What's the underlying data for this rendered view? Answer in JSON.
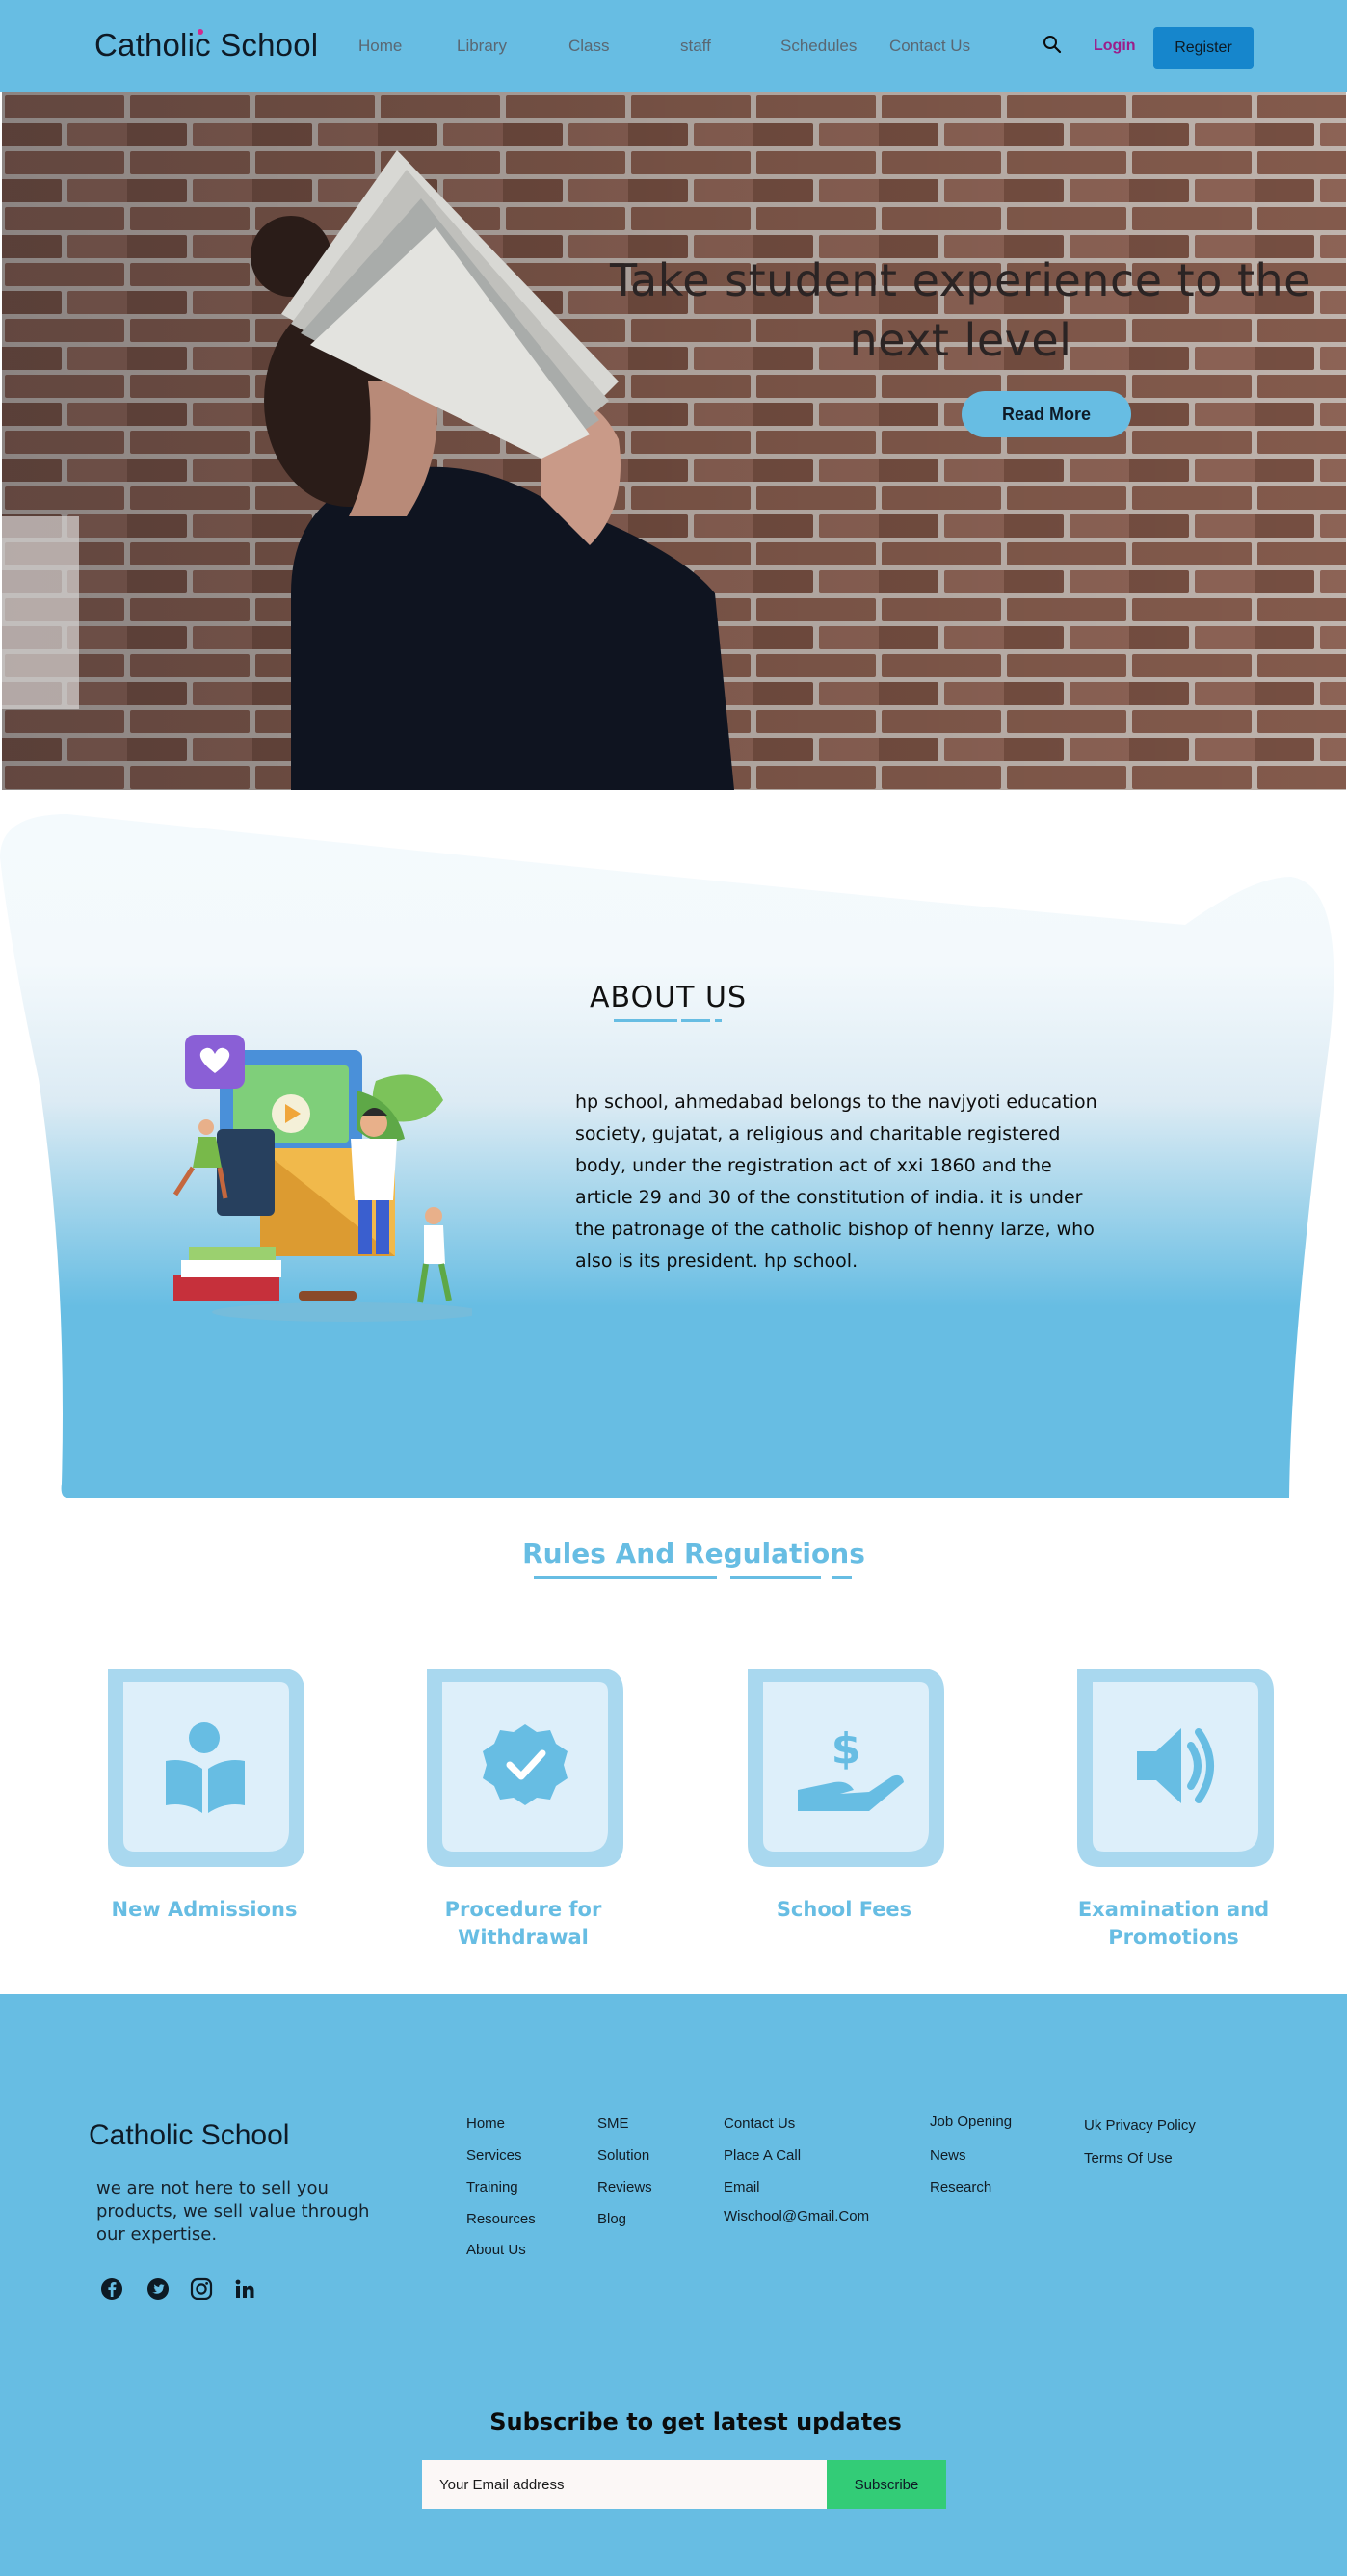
{
  "nav": {
    "brand": "Catholic School",
    "links": [
      "Home",
      "Library",
      "Class",
      "staff",
      "Schedules",
      "Contact Us"
    ],
    "login": "Login",
    "register": "Register"
  },
  "hero": {
    "title": "Take student experience to the next level",
    "cta": "Read More"
  },
  "about": {
    "title": "ABOUT US",
    "text": "hp school, ahmedabad belongs to the navjyoti education society, gujatat, a religious and charitable registered body, under the registration act of xxi 1860 and the article 29 and 30 of the constitution of india. it is under the patronage of the catholic bishop of henny larze, who also is its president. hp school."
  },
  "rules": {
    "title": "Rules And Regulations",
    "cards": [
      {
        "label": "New Admissions",
        "icon": "reading-person-icon"
      },
      {
        "label": "Procedure for Withdrawal",
        "icon": "verified-badge-icon"
      },
      {
        "label": "School Fees",
        "icon": "dollar-hand-icon"
      },
      {
        "label": "Examination and Promotions",
        "icon": "megaphone-icon"
      }
    ]
  },
  "footer": {
    "brand": "Catholic School",
    "tagline": "we are not here to sell you products, we sell value through our expertise.",
    "social": [
      "facebook-icon",
      "twitter-icon",
      "instagram-icon",
      "linkedin-icon"
    ],
    "col1": [
      "Home",
      "Services",
      "Training",
      "Resources",
      "About Us"
    ],
    "col2": [
      "SME",
      "Solution",
      "Reviews",
      "Blog"
    ],
    "col3": [
      "Contact Us",
      "Place A Call",
      "Email",
      "Wischool@Gmail.Com"
    ],
    "col4": [
      "Job Opening",
      "News",
      "Research"
    ],
    "col5": [
      "Uk Privacy Policy",
      "Terms Of Use"
    ],
    "subscribe_title": "Subscribe to get latest updates",
    "email_placeholder": "Your Email address",
    "subscribe_button": "Subscribe"
  },
  "colors": {
    "primary": "#67bde3",
    "register": "#1686cc",
    "login": "#9b1e8a",
    "subscribe": "#33cc77"
  }
}
